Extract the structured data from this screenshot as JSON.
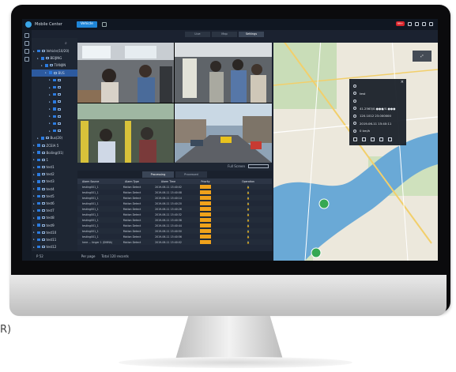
{
  "caption_fragment": "R)",
  "app": {
    "title": "Mobile Center",
    "active_tab": "Vehicle",
    "alarm_count": "99+"
  },
  "top_tabs": [
    "Live",
    "Map",
    "Settings"
  ],
  "tree": [
    {
      "label": "Vehicle(10/20)",
      "level": 0
    },
    {
      "label": "BEIJING",
      "level": 1
    },
    {
      "label": "TIANJIN",
      "level": 2
    },
    {
      "label": "BUS",
      "level": 3,
      "selected": true
    },
    {
      "label": "",
      "level": 4
    },
    {
      "label": "",
      "level": 4
    },
    {
      "label": "",
      "level": 4
    },
    {
      "label": "",
      "level": 4
    },
    {
      "label": "",
      "level": 4
    },
    {
      "label": "",
      "level": 4
    },
    {
      "label": "",
      "level": 4
    },
    {
      "label": "",
      "level": 4
    },
    {
      "label": "Bus(20)",
      "level": 1
    },
    {
      "label": "ZCEIA 5",
      "level": 0
    },
    {
      "label": "Boiling(01)",
      "level": 0
    },
    {
      "label": "1",
      "level": 0
    },
    {
      "label": "test1",
      "level": 0
    },
    {
      "label": "test2",
      "level": 0
    },
    {
      "label": "test3",
      "level": 0
    },
    {
      "label": "test4",
      "level": 0
    },
    {
      "label": "test5",
      "level": 0
    },
    {
      "label": "test6",
      "level": 0
    },
    {
      "label": "test7",
      "level": 0
    },
    {
      "label": "test8",
      "level": 0
    },
    {
      "label": "test9",
      "level": 0
    },
    {
      "label": "test10",
      "level": 0
    },
    {
      "label": "test11",
      "level": 0
    },
    {
      "label": "test12",
      "level": 0
    }
  ],
  "video": {
    "fullscreen_label": "Full Screen"
  },
  "sub_tabs": [
    "Processing",
    "Processed"
  ],
  "events": {
    "columns": [
      "Alarm Source",
      "Alarm Type",
      "Alarm Time",
      "Priority",
      "Operation"
    ],
    "rows": [
      {
        "source": "testing001_1",
        "type": "Motion Detect",
        "time": "2019-06-11 15:40:02"
      },
      {
        "source": "testing001_1",
        "type": "Motion Detect",
        "time": "2019-06-11 15:40:08"
      },
      {
        "source": "testing001_1",
        "type": "Motion Detect",
        "time": "2019-06-11 15:40:14"
      },
      {
        "source": "testing001_1",
        "type": "Motion Detect",
        "time": "2019-06-11 15:40:20"
      },
      {
        "source": "testing001_1",
        "type": "Motion Detect",
        "time": "2019-06-11 15:40:26"
      },
      {
        "source": "testing001_1",
        "type": "Motion Detect",
        "time": "2019-06-11 15:40:32"
      },
      {
        "source": "testing001_1",
        "type": "Motion Detect",
        "time": "2019-06-11 15:40:38"
      },
      {
        "source": "testing001_1",
        "type": "Motion Detect",
        "time": "2019-06-11 15:40:44"
      },
      {
        "source": "testing001_1",
        "type": "Motion Detect",
        "time": "2019-06-11 15:40:50"
      },
      {
        "source": "testing001_1",
        "type": "Motion Detect",
        "time": "2019-06-11 15:40:56"
      },
      {
        "source": "here ... tinger 1 (DNMA)",
        "type": "Motion Detect",
        "time": "2019-06-11 15:40:02"
      }
    ]
  },
  "footer": {
    "left": "P 52",
    "per_page": "Per page",
    "total": "Total 120 records"
  },
  "map_popup": {
    "rows": [
      "",
      "test",
      "",
      "41.2563/0.●●●/0.●●●",
      "120.1012 23.000000",
      "2019-06-11 15:40:11",
      "0 km/h"
    ]
  },
  "colors": {
    "accent": "#1f86d8",
    "priority": "#f0a21b",
    "alarm": "#d8232a",
    "river": "#6aa9d6"
  },
  "icons": [
    "search-icon",
    "home-icon",
    "alarm-icon",
    "gear-icon",
    "close-icon",
    "vehicle-marker-icon",
    "play-icon",
    "grid-icon"
  ]
}
